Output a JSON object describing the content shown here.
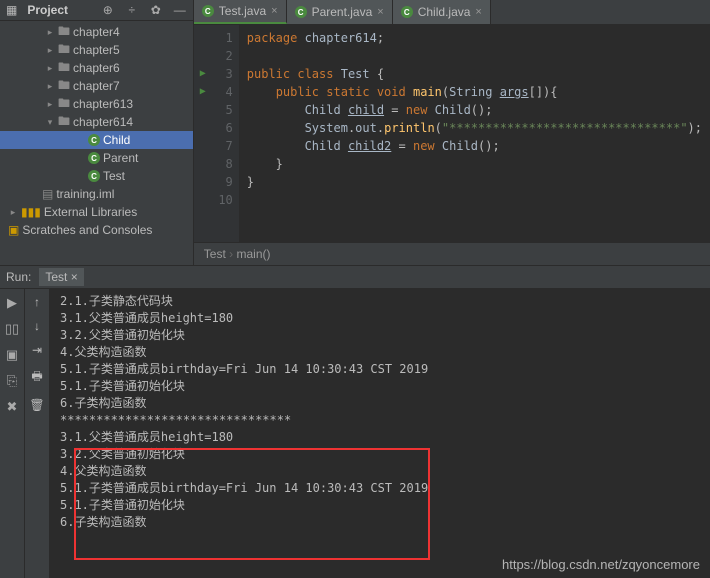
{
  "sidebar": {
    "title": "Project",
    "items": [
      {
        "label": "chapter4",
        "type": "folder",
        "arrow": "▸",
        "indent": "indent2"
      },
      {
        "label": "chapter5",
        "type": "folder",
        "arrow": "▸",
        "indent": "indent2"
      },
      {
        "label": "chapter6",
        "type": "folder",
        "arrow": "▸",
        "indent": "indent2"
      },
      {
        "label": "chapter7",
        "type": "folder",
        "arrow": "▸",
        "indent": "indent2"
      },
      {
        "label": "chapter613",
        "type": "folder",
        "arrow": "▸",
        "indent": "indent2"
      },
      {
        "label": "chapter614",
        "type": "folder",
        "arrow": "▾",
        "indent": "indent2"
      },
      {
        "label": "Child",
        "type": "class",
        "indent": "indent4",
        "selected": true
      },
      {
        "label": "Parent",
        "type": "class",
        "indent": "indent4"
      },
      {
        "label": "Test",
        "type": "class",
        "indent": "indent4"
      },
      {
        "label": "training.iml",
        "type": "file",
        "indent": "indent5"
      },
      {
        "label": "External Libraries",
        "type": "lib",
        "arrow": "▸",
        "indent": ""
      },
      {
        "label": "Scratches and Consoles",
        "type": "scratch",
        "indent": ""
      }
    ]
  },
  "tabs": [
    {
      "label": "Test.java",
      "active": true
    },
    {
      "label": "Parent.java",
      "active": false
    },
    {
      "label": "Child.java",
      "active": false
    }
  ],
  "code": {
    "lines": [
      {
        "n": "1",
        "html": "<span class='kw'>package</span> <span class='id'>chapter614</span>;"
      },
      {
        "n": "2",
        "html": ""
      },
      {
        "n": "3",
        "html": "<span class='kw'>public class</span> <span class='cls'>Test</span> {",
        "play": true
      },
      {
        "n": "4",
        "html": "    <span class='kw'>public static void</span> <span class='fn'>main</span>(<span class='cls'>String</span> <span class='id ul'>args</span>[]){",
        "play": true
      },
      {
        "n": "5",
        "html": "        <span class='cls'>Child</span> <span class='id ul'>child</span> = <span class='kw'>new</span> <span class='cls'>Child</span>();"
      },
      {
        "n": "6",
        "html": "        <span class='cls'>System</span>.<span class='id'>out</span>.<span class='fn'>println</span>(<span class='str'>\"********************************\"</span>);"
      },
      {
        "n": "7",
        "html": "        <span class='cls'>Child</span> <span class='id ul'>child2</span> = <span class='kw'>new</span> <span class='cls'>Child</span>();"
      },
      {
        "n": "8",
        "html": "    }"
      },
      {
        "n": "9",
        "html": "}"
      },
      {
        "n": "10",
        "html": ""
      }
    ]
  },
  "breadcrumb": {
    "a": "Test",
    "b": "main()"
  },
  "run": {
    "label": "Run:",
    "tab": "Test",
    "output": [
      "2.1.子类静态代码块",
      "3.1.父类普通成员height=180",
      "3.2.父类普通初始化块",
      "4.父类构造函数",
      "5.1.子类普通成员birthday=Fri Jun 14 10:30:43 CST 2019",
      "5.1.子类普通初始化块",
      "6.子类构造函数",
      "********************************",
      "3.1.父类普通成员height=180",
      "3.2.父类普通初始化块",
      "4.父类构造函数",
      "5.1.子类普通成员birthday=Fri Jun 14 10:30:43 CST 2019",
      "5.1.子类普通初始化块",
      "6.子类构造函数"
    ]
  },
  "watermark": "https://blog.csdn.net/zqyoncemore"
}
